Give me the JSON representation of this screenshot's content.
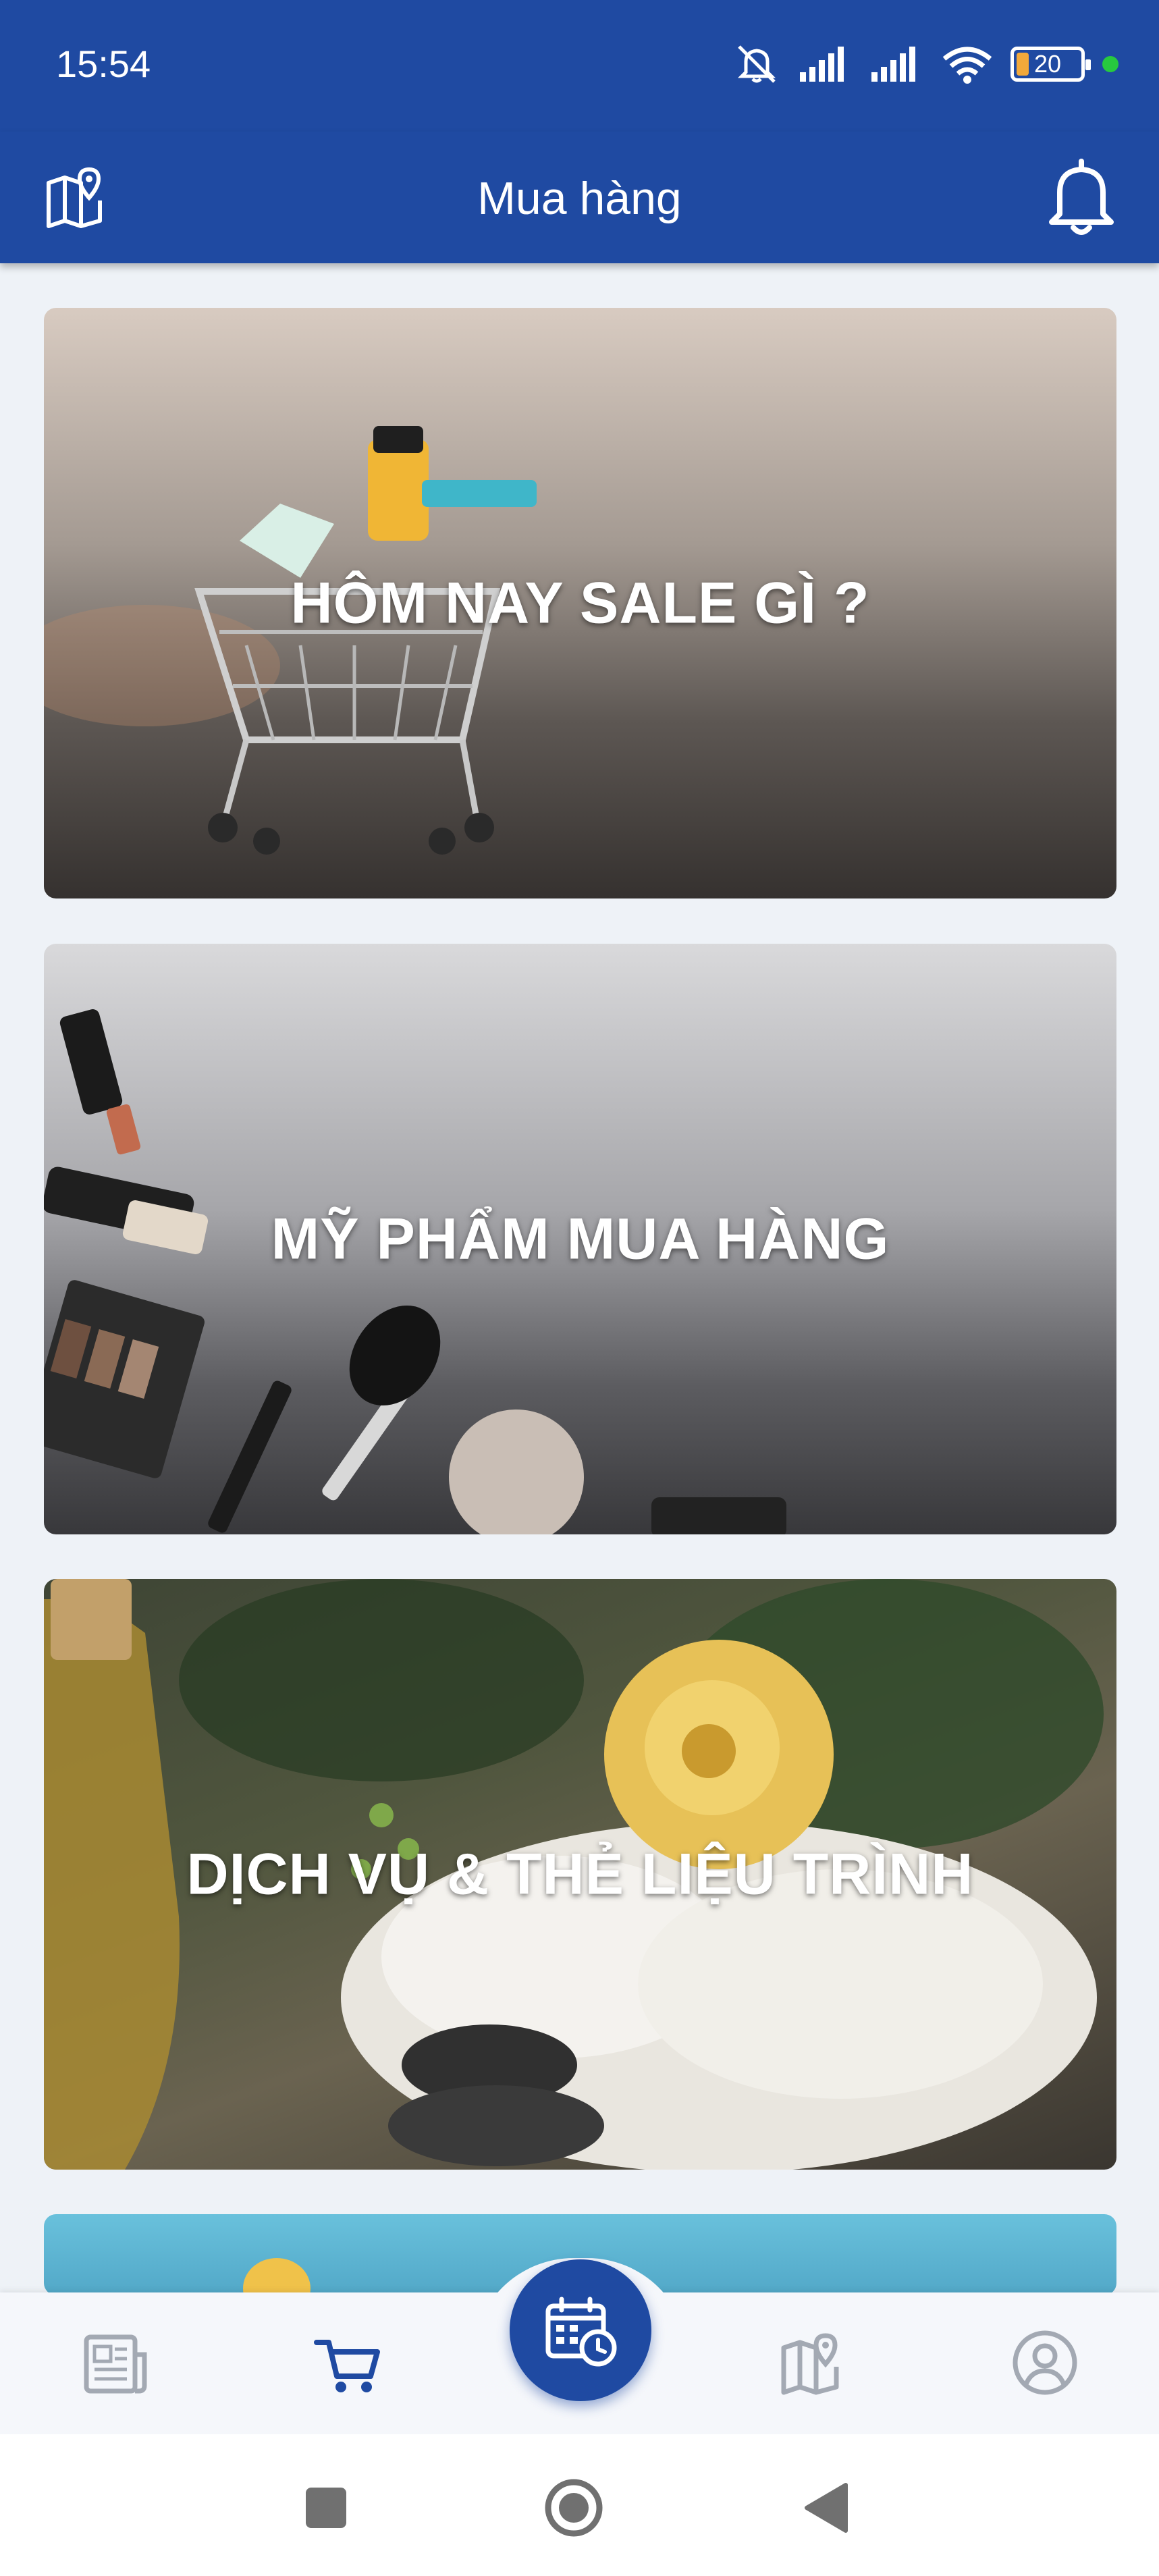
{
  "status_bar": {
    "time": "15:54",
    "battery_level": "20",
    "icons": [
      "mute-icon",
      "signal-icon",
      "signal-icon",
      "wifi-icon",
      "battery-icon",
      "active-dot"
    ]
  },
  "app_bar": {
    "title": "Mua hàng",
    "left_icon": "map-pin-icon",
    "right_icon": "bell-icon"
  },
  "cards": [
    {
      "title": "HÔM NAY SALE GÌ ?"
    },
    {
      "title": "MỸ PHẨM MUA HÀNG"
    },
    {
      "title": "DỊCH VỤ & THẺ LIỆU TRÌNH"
    },
    {
      "title": ""
    }
  ],
  "bottom_nav": {
    "items": [
      {
        "icon": "news-icon",
        "active": false
      },
      {
        "icon": "cart-icon",
        "active": true
      },
      {
        "icon": "calendar-clock-icon",
        "active": false
      },
      {
        "icon": "map-pin-icon",
        "active": false
      },
      {
        "icon": "profile-icon",
        "active": false
      }
    ]
  },
  "colors": {
    "primary": "#1f4aa2",
    "background": "#eef2f7",
    "inactive_icon": "#a3a9b3",
    "active_icon": "#1f4aa2"
  }
}
